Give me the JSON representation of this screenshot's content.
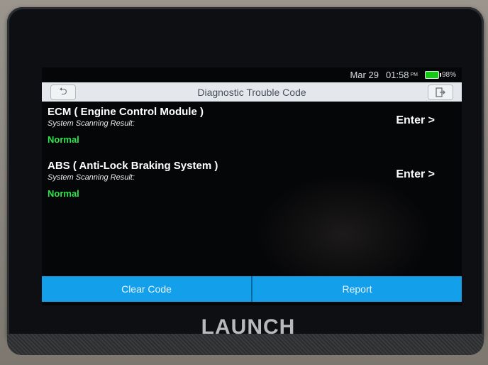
{
  "status_bar": {
    "date": "Mar 29",
    "time": "01:58",
    "ampm": "PM",
    "battery": "98%"
  },
  "header": {
    "title": "Diagnostic Trouble Code",
    "back_icon": "back-arrow-icon",
    "exit_icon": "exit-icon"
  },
  "modules": [
    {
      "name": "ECM ( Engine Control Module )",
      "subtitle": "System Scanning Result:",
      "status": "Normal",
      "enter_label": "Enter >"
    },
    {
      "name": "ABS ( Anti-Lock Braking System )",
      "subtitle": "System Scanning Result:",
      "status": "Normal",
      "enter_label": "Enter >"
    }
  ],
  "footer": {
    "clear_label": "Clear Code",
    "report_label": "Report"
  },
  "brand": "LAUNCH",
  "colors": {
    "accent": "#139fe9",
    "status_ok": "#2de54b",
    "header_bg": "#e4e7eb"
  }
}
